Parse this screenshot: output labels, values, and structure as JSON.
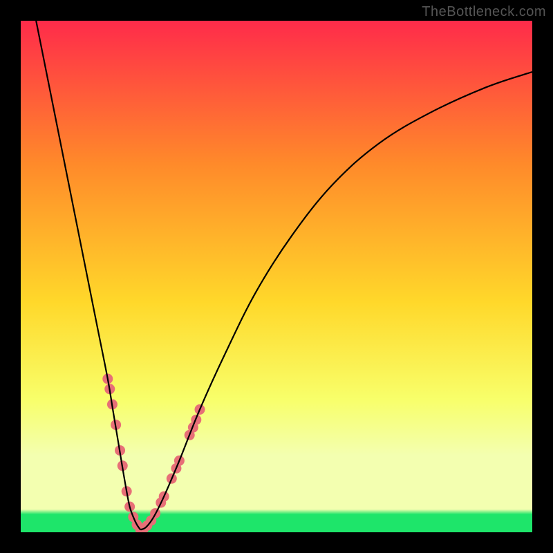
{
  "watermark": "TheBottleneck.com",
  "colors": {
    "top": "#ff2b4a",
    "upper_mid": "#ff8a2a",
    "mid": "#ffd82a",
    "lower_mid": "#f8ff6a",
    "pale": "#f3ffb0",
    "green": "#1ee56a",
    "black": "#000000",
    "curve": "#000000",
    "dot": "#e76f77",
    "watermark": "#555555"
  },
  "chart_data": {
    "type": "line",
    "title": "",
    "xlabel": "",
    "ylabel": "",
    "xlim": [
      0,
      100
    ],
    "ylim": [
      0,
      100
    ],
    "gradient_stops": [
      {
        "pos": 0.0,
        "color": "#ff2b4a"
      },
      {
        "pos": 0.28,
        "color": "#ff8a2a"
      },
      {
        "pos": 0.55,
        "color": "#ffd82a"
      },
      {
        "pos": 0.74,
        "color": "#f8ff6a"
      },
      {
        "pos": 0.85,
        "color": "#f3ffb0"
      },
      {
        "pos": 0.955,
        "color": "#f3ffb0"
      },
      {
        "pos": 0.965,
        "color": "#1ee56a"
      },
      {
        "pos": 1.0,
        "color": "#1ee56a"
      }
    ],
    "series": [
      {
        "name": "left-curve",
        "x": [
          3,
          5,
          7,
          9,
          11,
          13,
          15,
          17,
          18,
          19,
          20,
          20.7,
          21.3,
          22,
          22.7,
          23.4
        ],
        "values": [
          100,
          90,
          80,
          70,
          60,
          50,
          40,
          30,
          24,
          18,
          12,
          8,
          5,
          3,
          1.5,
          0.5
        ]
      },
      {
        "name": "right-curve",
        "x": [
          23.4,
          24.5,
          26,
          28,
          31,
          35,
          40,
          46,
          53,
          61,
          70,
          80,
          91,
          100
        ],
        "values": [
          0.5,
          1,
          3,
          7,
          14,
          24,
          35,
          47,
          58,
          68,
          76,
          82,
          87,
          90
        ]
      }
    ],
    "dots": {
      "name": "highlight-dots",
      "points": [
        {
          "x": 17.0,
          "y": 30
        },
        {
          "x": 17.4,
          "y": 28
        },
        {
          "x": 17.9,
          "y": 25
        },
        {
          "x": 18.6,
          "y": 21
        },
        {
          "x": 19.4,
          "y": 16
        },
        {
          "x": 19.9,
          "y": 13
        },
        {
          "x": 20.7,
          "y": 8
        },
        {
          "x": 21.3,
          "y": 5
        },
        {
          "x": 22.0,
          "y": 3
        },
        {
          "x": 22.7,
          "y": 1.5
        },
        {
          "x": 23.4,
          "y": 0.5
        },
        {
          "x": 24.0,
          "y": 0.7
        },
        {
          "x": 24.7,
          "y": 1.3
        },
        {
          "x": 25.5,
          "y": 2.3
        },
        {
          "x": 26.3,
          "y": 3.7
        },
        {
          "x": 27.4,
          "y": 5.8
        },
        {
          "x": 28.0,
          "y": 7
        },
        {
          "x": 29.5,
          "y": 10.5
        },
        {
          "x": 30.4,
          "y": 12.5
        },
        {
          "x": 31.0,
          "y": 14
        },
        {
          "x": 33.0,
          "y": 19
        },
        {
          "x": 33.7,
          "y": 20.5
        },
        {
          "x": 34.3,
          "y": 22
        },
        {
          "x": 35.0,
          "y": 24
        }
      ]
    }
  }
}
